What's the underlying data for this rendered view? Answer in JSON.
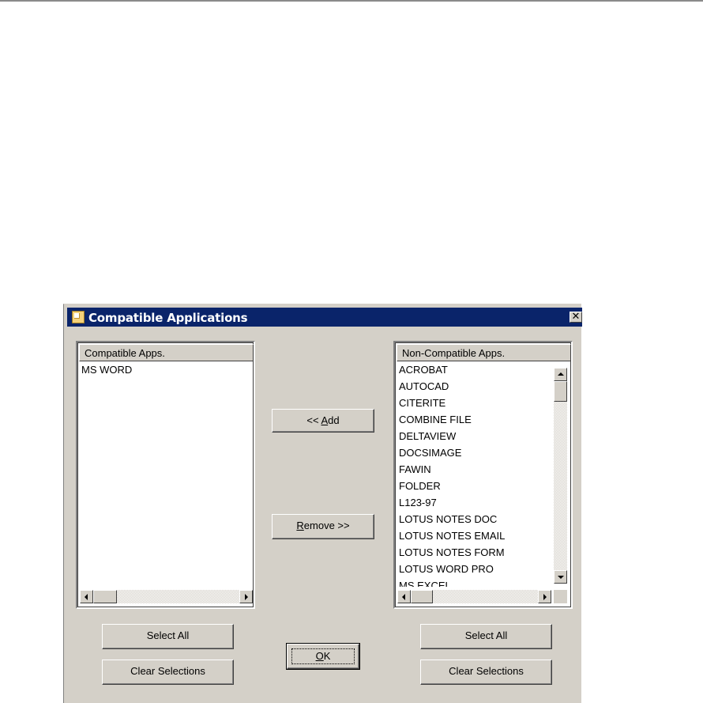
{
  "dialog": {
    "title": "Compatible Applications",
    "close_glyph": "✕"
  },
  "compatible": {
    "header": "Compatible Apps.",
    "items": [
      "MS WORD"
    ]
  },
  "noncompatible": {
    "header": "Non-Compatible Apps.",
    "items": [
      "ACROBAT",
      "AUTOCAD",
      "CITERITE",
      "COMBINE FILE",
      "DELTAVIEW",
      "DOCSIMAGE",
      "FAWIN",
      "FOLDER",
      "L123-97",
      "LOTUS NOTES DOC",
      "LOTUS NOTES EMAIL",
      "LOTUS NOTES FORM",
      "LOTUS WORD PRO",
      "MS EXCEL"
    ]
  },
  "buttons": {
    "add_prefix": "<< ",
    "add_mnemonic": "A",
    "add_rest": "dd",
    "remove_mnemonic": "R",
    "remove_rest": "emove >>",
    "select_all_left": "Select All",
    "clear_left": "Clear Selections",
    "ok_mnemonic": "O",
    "ok_rest": "K",
    "select_all_right": "Select All",
    "clear_right": "Clear Selections"
  },
  "colors": {
    "titlebar": "#0a246a",
    "face": "#d4d0c8"
  }
}
